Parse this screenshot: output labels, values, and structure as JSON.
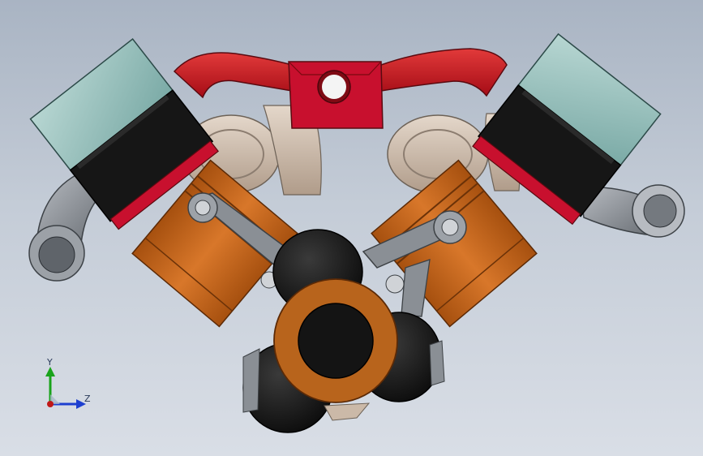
{
  "viewport": {
    "background_top": "#a9b4c3",
    "background_bottom": "#d9dee6"
  },
  "model": {
    "parts": [
      "motor-left",
      "motor-right",
      "intake-manifold",
      "throttle-body",
      "piston-left",
      "piston-right",
      "connecting-rod-left",
      "connecting-rod-right",
      "crankshaft",
      "flywheel-lobes",
      "exhaust-pipe-left",
      "exhaust-pipe-right",
      "cylinder-heads"
    ],
    "colors": {
      "manifold": "#c8102e",
      "motor_cap": "#8fb9b5",
      "motor_body": "#161616",
      "piston": "#c4661a",
      "rod": "#8a8f95",
      "crank_ring": "#b8641c",
      "lobe": "#1a1a1a",
      "head": "#cbb9a8",
      "exhaust": "#8e9398"
    }
  },
  "triad": {
    "y_label": "Y",
    "z_label": "Z",
    "y_color": "#19a31b",
    "z_color": "#1d3fd0",
    "x_color": "#c01818"
  }
}
